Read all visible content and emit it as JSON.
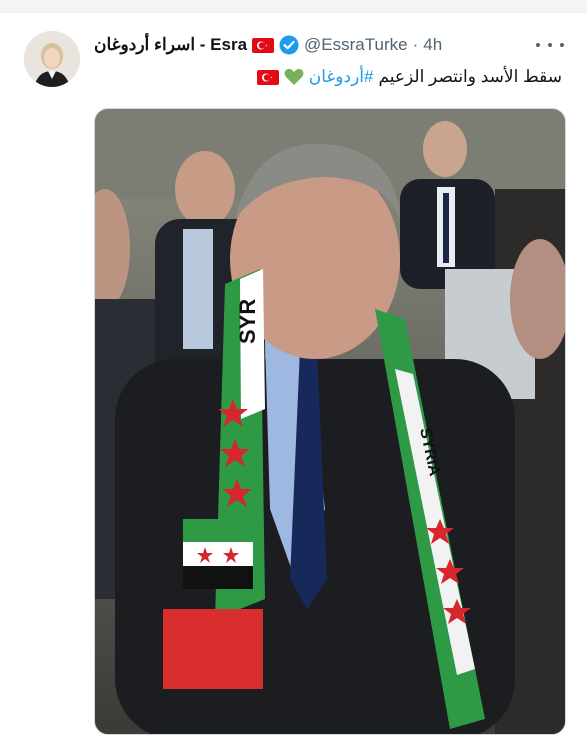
{
  "tweet": {
    "display_name": "اسراء أردوغان - Esra",
    "handle": "@EssraTurke",
    "separator": "·",
    "time": "4h",
    "text_main": "سقط الأسد وانتصر الزعيم",
    "hashtag": "#أردوغان",
    "emojis": [
      "green-heart",
      "turkey-flag"
    ],
    "verified": true
  },
  "media": {
    "scarf_text_left": "SYR",
    "scarf_text_right": "SYRIA"
  },
  "colors": {
    "link_blue": "#1d9bf0",
    "secondary_text": "#536471",
    "verified_blue": "#1d9bf0",
    "flag_red": "#e30a17",
    "heart_green": "#78b159"
  }
}
